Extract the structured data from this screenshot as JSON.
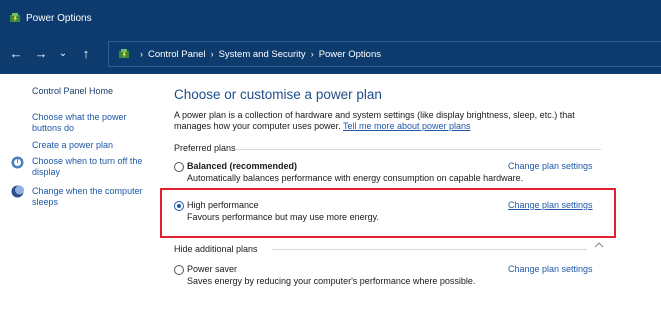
{
  "window": {
    "title": "Power Options"
  },
  "navigation": {
    "back_glyph": "←",
    "forward_glyph": "→",
    "recent_glyph": "⌄",
    "up_glyph": "↑",
    "breadcrumb_separator": "›",
    "breadcrumbs": [
      "Control Panel",
      "System and Security",
      "Power Options"
    ]
  },
  "sidebar": {
    "home": "Control Panel Home",
    "links": [
      {
        "label": "Choose what the power buttons do",
        "icon": ""
      },
      {
        "label": "Create a power plan",
        "icon": ""
      },
      {
        "label": "Choose when to turn off the display",
        "icon": "monitor-icon"
      },
      {
        "label": "Change when the computer sleeps",
        "icon": "moon-icon"
      }
    ]
  },
  "main": {
    "heading": "Choose or customise a power plan",
    "description": "A power plan is a collection of hardware and system settings (like display brightness, sleep, etc.) that manages how your computer uses power.",
    "learn_more_link": "Tell me more about power plans",
    "preferred_label": "Preferred plans",
    "hide_additional_label": "Hide additional plans",
    "plans": [
      {
        "name": "Balanced (recommended)",
        "description": "Automatically balances performance with energy consumption on capable hardware.",
        "selected": false,
        "change_label": "Change plan settings"
      },
      {
        "name": "High performance",
        "description": "Favours performance but may use more energy.",
        "selected": true,
        "change_label": "Change plan settings"
      },
      {
        "name": "Power saver",
        "description": "Saves energy by reducing your computer's performance where possible.",
        "selected": false,
        "change_label": "Change plan settings"
      }
    ]
  },
  "colors": {
    "titlebar": "#0d3b6e",
    "link": "#1f58a8",
    "heading": "#1f4e8a",
    "highlight": "#e0202e"
  }
}
